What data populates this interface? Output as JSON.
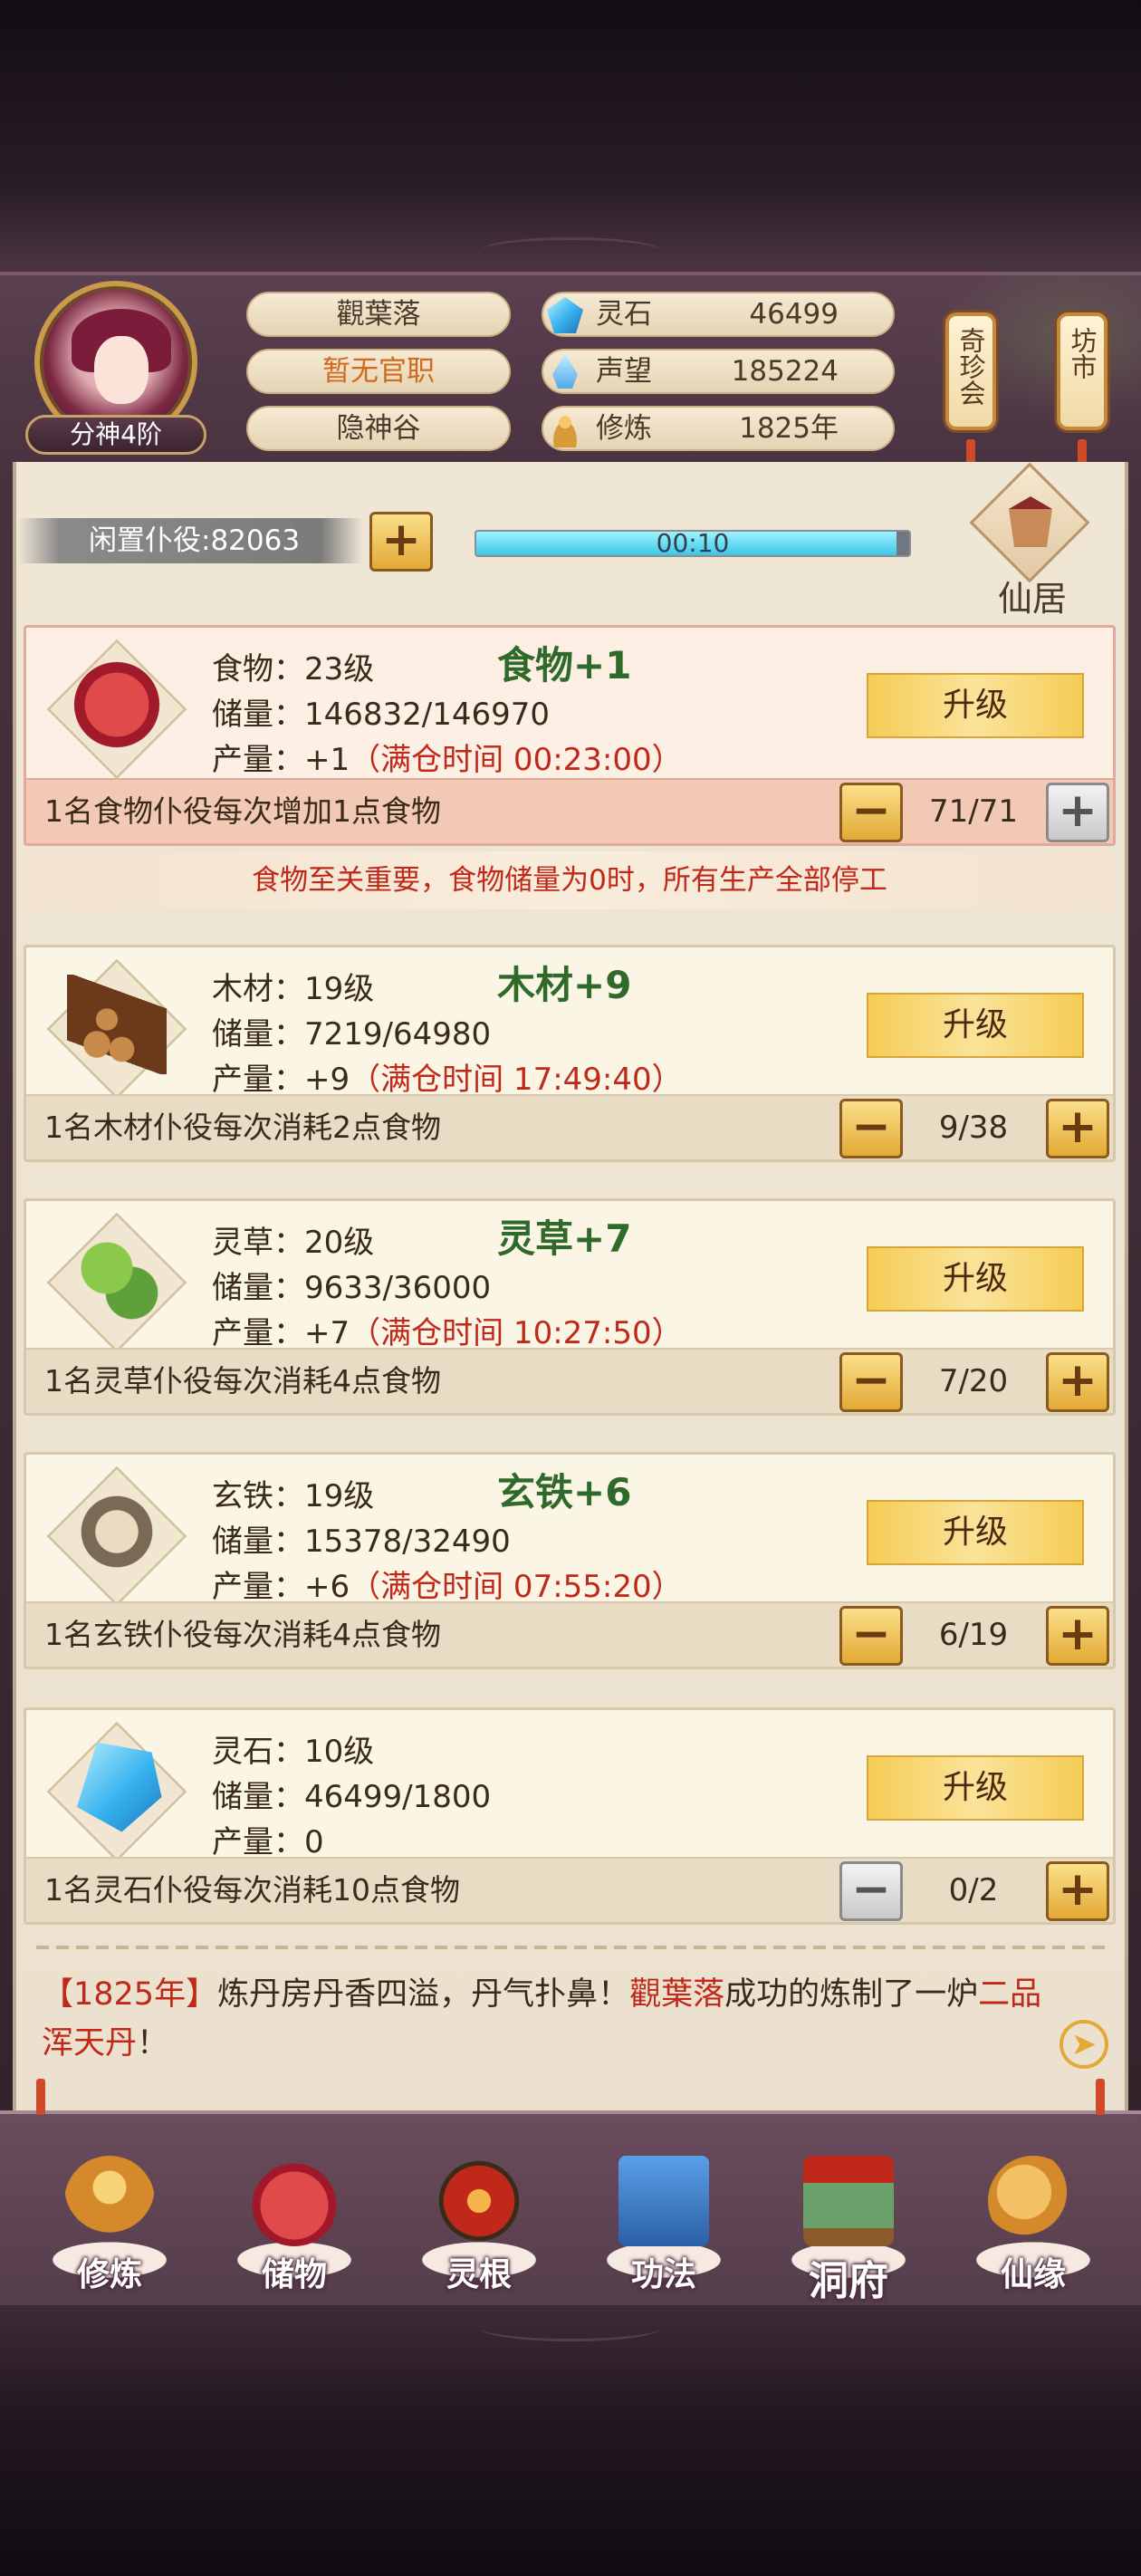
{
  "profile": {
    "rank": "分神4阶",
    "name": "觀葉落",
    "official_title": "暂无官职",
    "sect": "隐神谷"
  },
  "stats": [
    {
      "icon": "spirit-stone-icon",
      "label": "灵石",
      "value": "46499"
    },
    {
      "icon": "prestige-icon",
      "label": "声望",
      "value": "185224"
    },
    {
      "icon": "cultivation-icon",
      "label": "修炼",
      "value": "1825年"
    }
  ],
  "side_buttons": {
    "treasure_fair": "奇珍会",
    "market": "坊市"
  },
  "idle": {
    "label": "闲置仆役:82063",
    "timer": "00:10",
    "timer_progress": 0.97
  },
  "residence_label": "仙居",
  "upgrade_label": "升级",
  "resources": [
    {
      "key": "food",
      "level": "食物：23级",
      "gain": "食物+1",
      "storage": "储量：146832/146970",
      "production_prefix": "产量：+1",
      "production_note": "（满仓时间 00:23:00）",
      "footer": "1名食物仆役每次增加1点食物",
      "workers": "71/71"
    },
    {
      "key": "wood",
      "level": "木材：19级",
      "gain": "木材+9",
      "storage": "储量：7219/64980",
      "production_prefix": "产量：+9",
      "production_note": "（满仓时间 17:49:40）",
      "footer": "1名木材仆役每次消耗2点食物",
      "workers": "9/38"
    },
    {
      "key": "herb",
      "level": "灵草：20级",
      "gain": "灵草+7",
      "storage": "储量：9633/36000",
      "production_prefix": "产量：+7",
      "production_note": "（满仓时间 10:27:50）",
      "footer": "1名灵草仆役每次消耗4点食物",
      "workers": "7/20"
    },
    {
      "key": "iron",
      "level": "玄铁：19级",
      "gain": "玄铁+6",
      "storage": "储量：15378/32490",
      "production_prefix": "产量：+6",
      "production_note": "（满仓时间 07:55:20）",
      "footer": "1名玄铁仆役每次消耗4点食物",
      "workers": "6/19"
    },
    {
      "key": "stone",
      "level": "灵石：10级",
      "gain": "",
      "storage": "储量：46499/1800",
      "production_prefix": "产量：0",
      "production_note": "",
      "footer": "1名灵石仆役每次消耗10点食物",
      "workers": "0/2"
    }
  ],
  "food_warning": "食物至关重要，食物储量为0时，所有生产全部停工",
  "log": {
    "year": "【1825年】",
    "text1": "炼丹房丹香四溢，丹气扑鼻！",
    "name": "觀葉落",
    "text2": "成功的炼制了一炉",
    "item_a": "二品",
    "item_b": "浑天丹",
    "end": "！"
  },
  "nav": [
    {
      "label": "修炼",
      "icon": "cultivate-icon"
    },
    {
      "label": "储物",
      "icon": "storage-bag-icon"
    },
    {
      "label": "灵根",
      "icon": "spirit-root-icon"
    },
    {
      "label": "功法",
      "icon": "technique-book-icon"
    },
    {
      "label": "洞府",
      "icon": "cave-dwelling-icon"
    },
    {
      "label": "仙缘",
      "icon": "immortal-fate-icon"
    }
  ]
}
